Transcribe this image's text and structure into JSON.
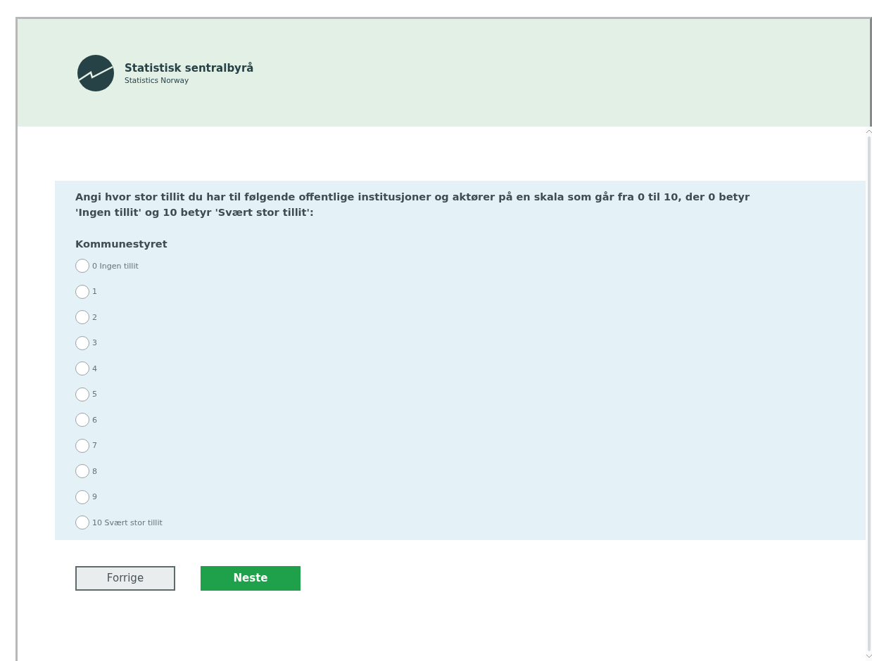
{
  "header": {
    "org_name": "Statistisk sentralbyrå",
    "org_subtitle": "Statistics Norway"
  },
  "question": {
    "prompt": "Angi hvor stor tillit du har til følgende offentlige institusjoner og aktører på en skala som går fra 0 til 10, der 0 betyr 'Ingen tillit' og 10 betyr 'Svært stor tillit':",
    "item": "Kommunestyret",
    "options": [
      {
        "label": "0 Ingen tillit",
        "selected": false
      },
      {
        "label": "1",
        "selected": false
      },
      {
        "label": "2",
        "selected": false
      },
      {
        "label": "3",
        "selected": false
      },
      {
        "label": "4",
        "selected": false
      },
      {
        "label": "5",
        "selected": false
      },
      {
        "label": "6",
        "selected": false
      },
      {
        "label": "7",
        "selected": false
      },
      {
        "label": "8",
        "selected": false
      },
      {
        "label": "9",
        "selected": false
      },
      {
        "label": "10 Svært stor tillit",
        "selected": false
      }
    ]
  },
  "buttons": [
    {
      "label": "Forrige",
      "kind": "secondary"
    },
    {
      "label": "Neste",
      "kind": "primary"
    }
  ]
}
